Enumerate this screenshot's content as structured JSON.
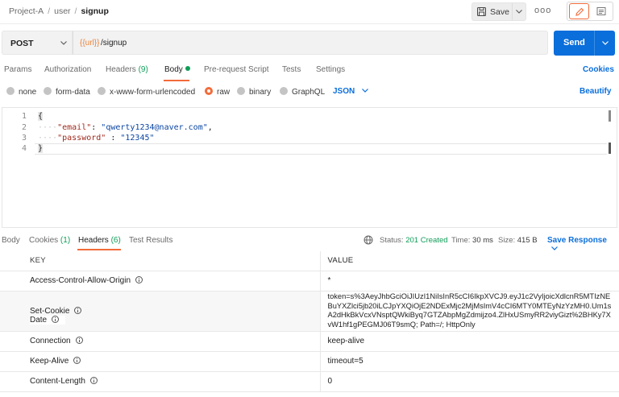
{
  "breadcrumb": {
    "project": "Project-A",
    "folder": "user",
    "sep": "/",
    "request": "signup"
  },
  "header": {
    "save_label": "Save",
    "more_label": "ooo"
  },
  "request": {
    "method": "POST",
    "url_variable": "{{url}}",
    "url_path": "/signup",
    "send_label": "Send"
  },
  "request_tabs": {
    "params": "Params",
    "authorization": "Authorization",
    "headers_label": "Headers",
    "headers_count": "(9)",
    "body": "Body",
    "prerequest": "Pre-request Script",
    "tests": "Tests",
    "settings": "Settings",
    "cookies": "Cookies"
  },
  "body_types": {
    "none": "none",
    "form_data": "form-data",
    "urlencoded": "x-www-form-urlencoded",
    "raw": "raw",
    "binary": "binary",
    "graphql": "GraphQL",
    "format": "JSON",
    "beautify": "Beautify"
  },
  "editor": {
    "line_numbers": [
      "1",
      "2",
      "3",
      "4"
    ],
    "line1": "{",
    "line2_key": "\"email\"",
    "line2_sep": ": ",
    "line2_val": "\"qwerty1234@naver.com\"",
    "line2_end": ",",
    "line3_key": "\"password\"",
    "line3_sep": " : ",
    "line3_val": "\"12345\"",
    "line4": "}"
  },
  "response_tabs": {
    "body": "Body",
    "cookies_label": "Cookies",
    "cookies_count": "(1)",
    "headers_label": "Headers",
    "headers_count": "(6)",
    "test_results": "Test Results"
  },
  "response_status": {
    "status_label": "Status:",
    "status_value": "201 Created",
    "time_label": "Time:",
    "time_value": "30 ms",
    "size_label": "Size:",
    "size_value": "415 B",
    "save_response": "Save Response"
  },
  "response_headers": {
    "col_key": "KEY",
    "col_value": "VALUE",
    "rows": [
      {
        "key": "Access-Control-Allow-Origin",
        "value": "*"
      },
      {
        "key": "Set-Cookie",
        "value": "token=s%3AeyJhbGciOiJIUzI1NiIsInR5cCI6IkpXVCJ9.eyJ1c2VyIjoicXdlcnR5MTIzNEBuYXZlci5jb20iLCJpYXQiOjE2NDExMjc2MjMsImV4cCI6MTY0MTEyNzYzMH0.Um1sA2dHkBkVcxVNsptQWkiByq7GTZAbpMgZdmijzo4.ZlHxUSmyRR2viyGizt%2BHKy7XvW1hf1gPEGMJ06T9smQ; Path=/; HttpOnly"
      },
      {
        "key": "Date",
        "value": ""
      },
      {
        "key": "Connection",
        "value": "keep-alive"
      },
      {
        "key": "Keep-Alive",
        "value": "timeout=5"
      },
      {
        "key": "Content-Length",
        "value": "0"
      }
    ]
  }
}
